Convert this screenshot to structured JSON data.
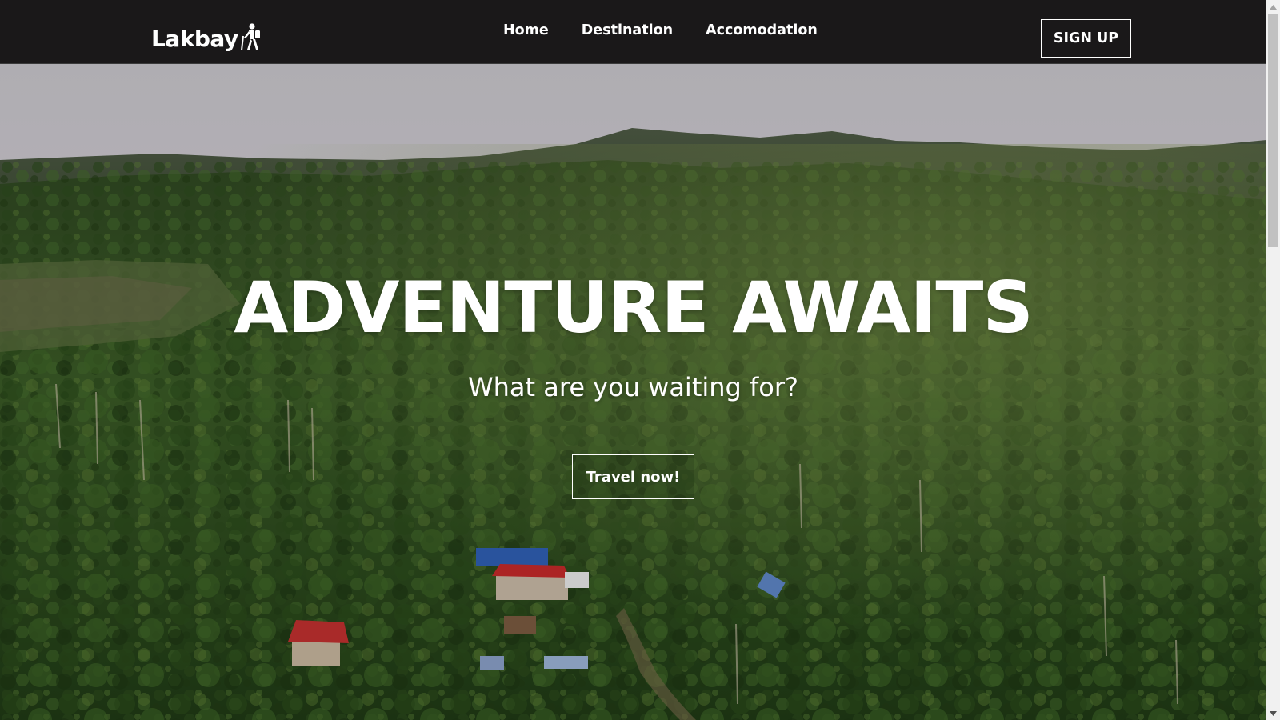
{
  "brand": {
    "name": "Lakbay",
    "icon": "hiker-icon"
  },
  "nav": {
    "items": [
      {
        "label": "Home"
      },
      {
        "label": "Destination"
      },
      {
        "label": "Accomodation"
      }
    ],
    "signup_label": "SIGN UP"
  },
  "hero": {
    "title": "ADVENTURE AWAITS",
    "subtitle": "What are you waiting for?",
    "cta_label": "Travel now!",
    "background": "aerial-palm-forest-village"
  },
  "colors": {
    "navbar_bg": "#1a1819",
    "text": "#ffffff",
    "forest_dark": "#1f3316",
    "forest_mid": "#3e5b28",
    "sky": "#c9c6cc"
  }
}
